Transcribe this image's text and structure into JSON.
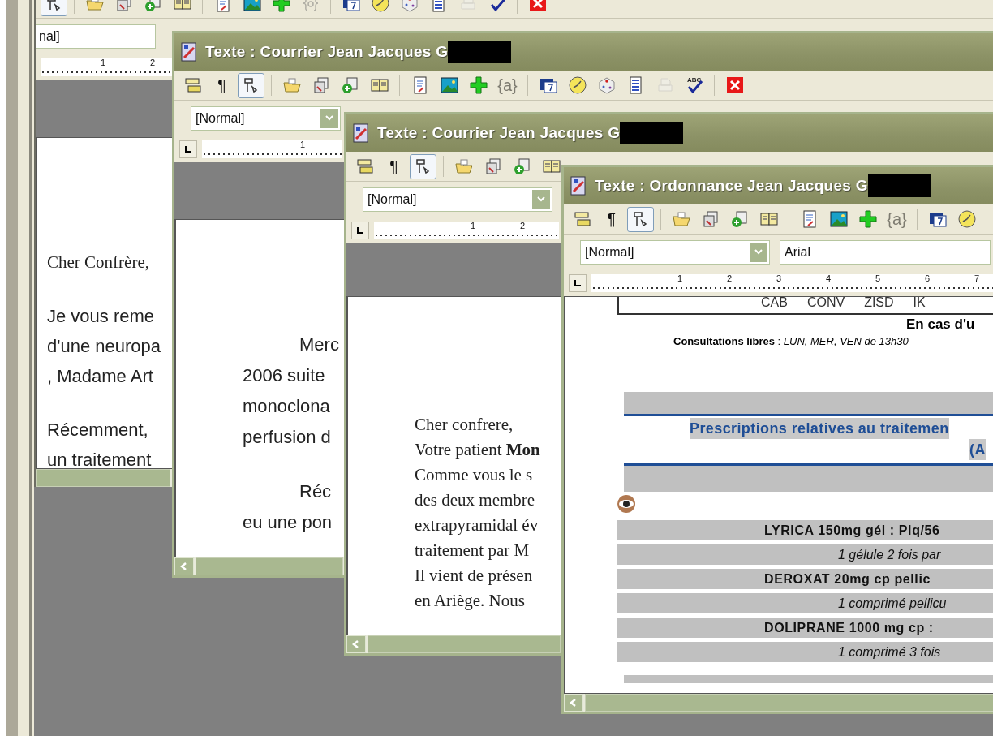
{
  "windows": [
    {
      "toolbar": [
        {
          "kind": "frame",
          "pressed": true,
          "disabled": false
        },
        {
          "kind": "open",
          "pressed": false,
          "disabled": false
        },
        {
          "kind": "copy",
          "pressed": false,
          "disabled": false
        },
        {
          "kind": "add",
          "pressed": false,
          "disabled": false
        },
        {
          "kind": "book",
          "pressed": false,
          "disabled": false
        },
        {
          "kind": "doc",
          "pressed": false,
          "disabled": false
        },
        {
          "kind": "image",
          "pressed": false,
          "disabled": false
        },
        {
          "kind": "plus",
          "pressed": false,
          "disabled": false
        },
        {
          "kind": "field",
          "pressed": false,
          "disabled": true
        },
        {
          "kind": "calendar",
          "pressed": false,
          "disabled": false
        },
        {
          "kind": "clock",
          "pressed": false,
          "disabled": false
        },
        {
          "kind": "dice",
          "pressed": false,
          "disabled": false
        },
        {
          "kind": "list",
          "pressed": false,
          "disabled": false
        },
        {
          "kind": "stamp",
          "pressed": false,
          "disabled": true
        },
        {
          "kind": "spell",
          "disabled": false
        },
        {
          "kind": "close",
          "pressed": false,
          "disabled": false
        }
      ],
      "style_field": "nal]",
      "ruler_marks": [
        "1",
        "2"
      ],
      "page_band": true,
      "lines": [
        {
          "kind": "serif",
          "text": "Cher Confrère,"
        },
        {
          "kind": "para",
          "text": "Je vous reme"
        },
        {
          "kind": "line",
          "text": "d'une neuropa"
        },
        {
          "kind": "line",
          "text": ", Madame Art"
        },
        {
          "kind": "para",
          "text": "Récemment,"
        },
        {
          "kind": "line",
          "text": "un traitement"
        }
      ]
    },
    {
      "title": "Texte : Courrier Jean Jacques G",
      "redacted": true,
      "toolbar": [
        {
          "kind": "layout",
          "pressed": false,
          "disabled": false
        },
        {
          "kind": "pilcrow",
          "text": "¶",
          "pressed": false,
          "disabled": false
        },
        {
          "kind": "frame",
          "pressed": true,
          "disabled": false
        },
        {
          "kind": "open",
          "pressed": false,
          "disabled": false
        },
        {
          "kind": "copy",
          "pressed": false,
          "disabled": false
        },
        {
          "kind": "add",
          "pressed": false,
          "disabled": false
        },
        {
          "kind": "book",
          "pressed": false,
          "disabled": false
        },
        {
          "kind": "doc",
          "pressed": false,
          "disabled": false
        },
        {
          "kind": "image",
          "pressed": false,
          "disabled": false
        },
        {
          "kind": "plus",
          "pressed": false,
          "disabled": false
        },
        {
          "kind": "field",
          "text": "{a}",
          "pressed": false,
          "disabled": true
        },
        {
          "kind": "calendar",
          "pressed": false,
          "disabled": false
        },
        {
          "kind": "clock",
          "pressed": false,
          "disabled": false
        },
        {
          "kind": "dice",
          "pressed": false,
          "disabled": false
        },
        {
          "kind": "list",
          "pressed": false,
          "disabled": false
        },
        {
          "kind": "stamp",
          "pressed": false,
          "disabled": true
        },
        {
          "kind": "spell",
          "text": "ABC",
          "disabled": false
        },
        {
          "kind": "close",
          "pressed": false,
          "disabled": false
        }
      ],
      "style_field": "[Normal]",
      "ruler_marks": [
        "1"
      ],
      "page_band": true,
      "lines": [
        {
          "kind": "indent",
          "text": "Merc"
        },
        {
          "kind": "line",
          "text": "2006 suite"
        },
        {
          "kind": "line",
          "text": "monoclona"
        },
        {
          "kind": "line",
          "text": "perfusion d"
        },
        {
          "kind": "indent",
          "text": "Réc"
        },
        {
          "kind": "line",
          "text": "eu une pon"
        }
      ]
    },
    {
      "title": "Texte : Courrier Jean Jacques G",
      "redacted": true,
      "toolbar": [
        {
          "kind": "layout",
          "pressed": false,
          "disabled": false
        },
        {
          "kind": "pilcrow",
          "text": "¶",
          "pressed": false,
          "disabled": false
        },
        {
          "kind": "frame",
          "pressed": true,
          "disabled": false
        },
        {
          "kind": "open",
          "pressed": false,
          "disabled": false
        },
        {
          "kind": "copy",
          "pressed": false,
          "disabled": false
        },
        {
          "kind": "add",
          "pressed": false,
          "disabled": false
        },
        {
          "kind": "book",
          "pressed": false,
          "disabled": false
        }
      ],
      "style_field": "[Normal]",
      "ruler_marks": [
        "1",
        "2"
      ],
      "page_band": true,
      "lines": [
        {
          "kind": "serif",
          "text": "Cher confrere,"
        },
        {
          "kind": "serif",
          "text": "Votre patient **Mon**"
        },
        {
          "kind": "serif",
          "text": "Comme vous le s"
        },
        {
          "kind": "serif",
          "text": "des deux membre"
        },
        {
          "kind": "serif",
          "text": "extrapyramidal év"
        },
        {
          "kind": "serif",
          "text": "traitement par M"
        },
        {
          "kind": "serif",
          "text": "Il vient de présen"
        },
        {
          "kind": "serif",
          "text": "en Ariège. Nous"
        }
      ]
    },
    {
      "title": "Texte : Ordonnance Jean Jacques G",
      "redacted": true,
      "toolbar": [
        {
          "kind": "layout",
          "pressed": false,
          "disabled": false
        },
        {
          "kind": "pilcrow",
          "text": "¶",
          "pressed": false,
          "disabled": false
        },
        {
          "kind": "frame",
          "pressed": true,
          "disabled": false
        },
        {
          "kind": "open",
          "pressed": false,
          "disabled": false
        },
        {
          "kind": "copy",
          "pressed": false,
          "disabled": false
        },
        {
          "kind": "add",
          "pressed": false,
          "disabled": false
        },
        {
          "kind": "book",
          "pressed": false,
          "disabled": false
        },
        {
          "kind": "doc",
          "pressed": false,
          "disabled": false
        },
        {
          "kind": "image",
          "pressed": false,
          "disabled": false
        },
        {
          "kind": "plus",
          "pressed": false,
          "disabled": false
        },
        {
          "kind": "field",
          "text": "{a}",
          "pressed": false,
          "disabled": true
        },
        {
          "kind": "calendar",
          "pressed": false,
          "disabled": false
        },
        {
          "kind": "clock",
          "pressed": false,
          "disabled": false
        }
      ],
      "style_field": "[Normal]",
      "font_field": "Arial",
      "ruler_marks": [
        "1",
        "2",
        "3",
        "4",
        "5",
        "6",
        "7"
      ],
      "page_band": false,
      "blocks": [
        {
          "kind": "header",
          "cells": [
            "CAB",
            "CONV",
            "ZISD",
            "IK"
          ]
        },
        {
          "kind": "notice",
          "text": "En cas d'u"
        },
        {
          "kind": "consult",
          "text": "**Consultations libres** : *LUN, MER, VEN de 13h30*"
        },
        {
          "kind": "band"
        },
        {
          "kind": "heading",
          "lines": [
            "Prescriptions relatives au traitemen",
            "(A"
          ]
        },
        {
          "kind": "band"
        },
        {
          "kind": "eye"
        },
        {
          "kind": "drug",
          "text": "LYRICA 150mg gél : Plq/56"
        },
        {
          "kind": "dose",
          "text": "1 gélule 2 fois par"
        },
        {
          "kind": "drug",
          "text": "DEROXAT 20mg cp pellic"
        },
        {
          "kind": "dose",
          "text": "1 comprimé pellicu"
        },
        {
          "kind": "drug",
          "text": "DOLIPRANE 1000 mg cp :"
        },
        {
          "kind": "dose",
          "text": "1 comprimé 3 fois"
        },
        {
          "kind": "end"
        }
      ]
    }
  ]
}
